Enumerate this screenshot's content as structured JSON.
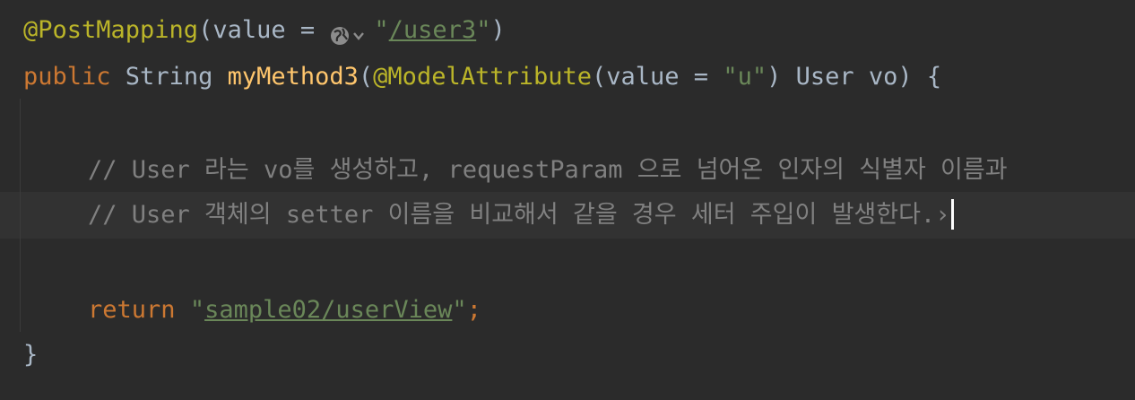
{
  "code": {
    "line1": {
      "annotation": "@PostMapping",
      "open": "(value = ",
      "quote_open": "\"",
      "path": "/user3",
      "quote_close": "\"",
      "close": ")"
    },
    "line2": {
      "kw_public": "public",
      "type_string": " String ",
      "method": "myMethod3",
      "open": "(",
      "annotation": "@ModelAttribute",
      "args": "(value = ",
      "str_u": "\"u\"",
      "rest": ") User vo) {"
    },
    "line4_comment": "// User 라는 vo를 생성하고, requestParam 으로 넘어온 인자의 식별자 이름과",
    "line5_comment": "// User 객체의 setter 이름을 비교해서 같을 경우 세터 주입이 발생한다.",
    "line5_folded": "›",
    "line7": {
      "kw_return": "return",
      "space": " ",
      "quote_open": "\"",
      "path": "sample02/userView",
      "quote_close": "\"",
      "semicolon": ";"
    },
    "line8": "}"
  },
  "colors": {
    "background": "#2b2b2b",
    "current_line": "#323232",
    "annotation": "#bbb529",
    "keyword": "#cc7832",
    "method": "#ffc66d",
    "string": "#6a8759",
    "comment": "#808080",
    "text": "#a9b7c6"
  }
}
